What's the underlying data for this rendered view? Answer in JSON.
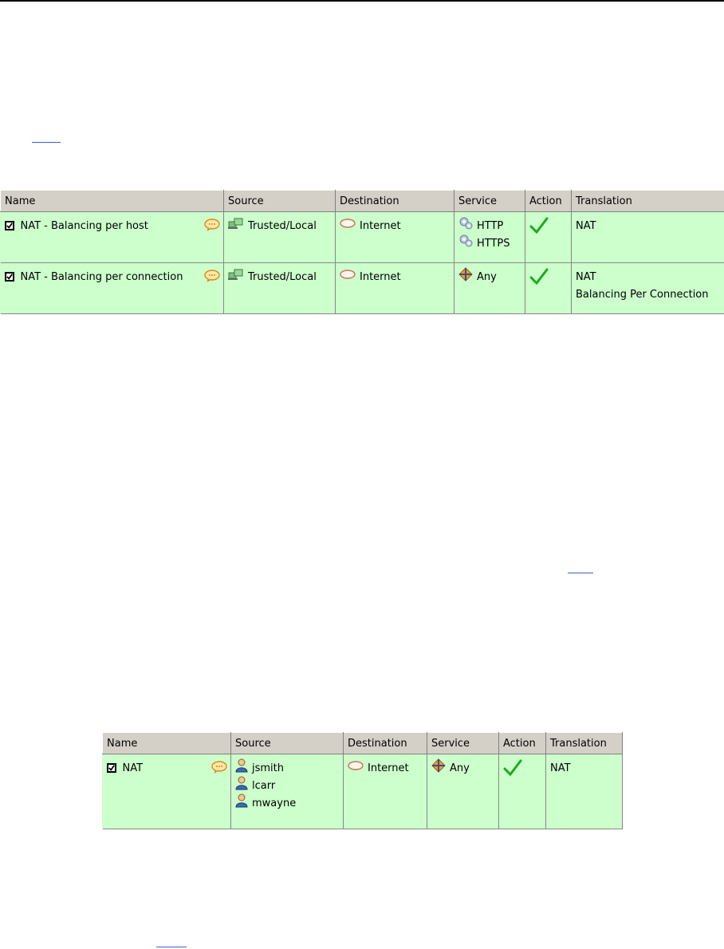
{
  "table1": {
    "columns": [
      "Name",
      "Source",
      "Destination",
      "Service",
      "Action",
      "Translation"
    ],
    "rows": [
      {
        "name": "NAT - Balancing per host",
        "source": "Trusted/Local",
        "destination": "Internet",
        "services": [
          "HTTP",
          "HTTPS"
        ],
        "translation": [
          "NAT"
        ]
      },
      {
        "name": "NAT - Balancing per connection",
        "source": "Trusted/Local",
        "destination": "Internet",
        "services": [
          "Any"
        ],
        "translation": [
          "NAT",
          "Balancing Per Connection"
        ]
      }
    ]
  },
  "table2": {
    "columns": [
      "Name",
      "Source",
      "Destination",
      "Service",
      "Action",
      "Translation"
    ],
    "rows": [
      {
        "name": "NAT",
        "sources": [
          "jsmith",
          "lcarr",
          "mwayne"
        ],
        "destination": "Internet",
        "services": [
          "Any"
        ],
        "translation": [
          "NAT"
        ]
      }
    ]
  },
  "icons": {
    "checkbox": "checkbox-checked-icon",
    "comment": "comment-bubble-icon",
    "network": "network-computers-icon",
    "internet": "internet-cloud-icon",
    "service": "gear-service-icon",
    "any": "any-service-icon",
    "user": "user-icon",
    "allow": "allow-check-icon"
  },
  "colors": {
    "row_bg": "#ccffcc",
    "header_bg": "#d4d0c8",
    "check_green": "#1fa81f",
    "link": "#3a5fcd"
  }
}
